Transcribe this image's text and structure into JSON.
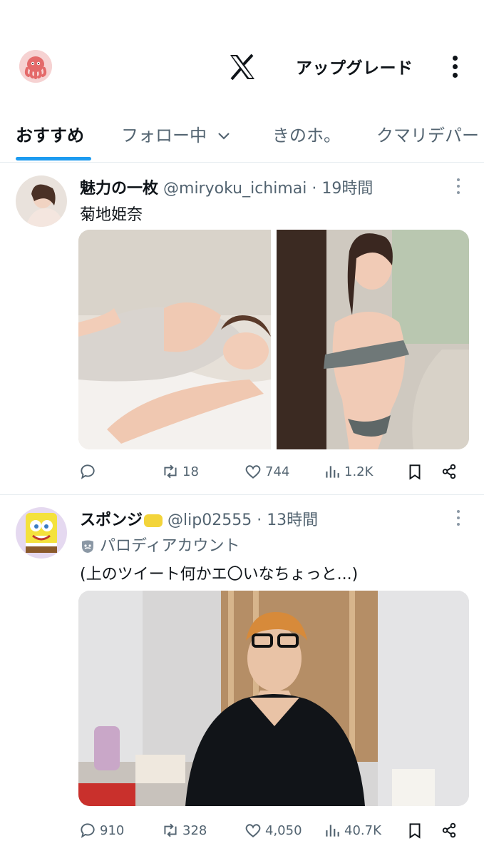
{
  "header": {
    "upgrade_label": "アップグレード"
  },
  "tabs": [
    {
      "label": "おすすめ",
      "active": true
    },
    {
      "label": "フォロー中",
      "dropdown": true
    },
    {
      "label": "きのホ。"
    },
    {
      "label": "クマリデパー"
    }
  ],
  "posts": [
    {
      "name": "魅力の一枚",
      "handle": "@miryoku_ichimai",
      "time": "· 19時間",
      "text": "菊地姫奈",
      "stats": {
        "replies": "",
        "reposts": "18",
        "likes": "744",
        "views": "1.2K"
      }
    },
    {
      "name": "スポンジ",
      "handle": "@lip02555",
      "time": "· 13時間",
      "label": "パロディアカウント",
      "text": "(上のツイート何かエ〇いなちょっと...)",
      "stats": {
        "replies": "910",
        "reposts": "328",
        "likes": "4,050",
        "views": "40.7K"
      }
    }
  ],
  "colors": {
    "accent": "#1d9bf0",
    "muted": "#536471",
    "text": "#0f1419"
  }
}
